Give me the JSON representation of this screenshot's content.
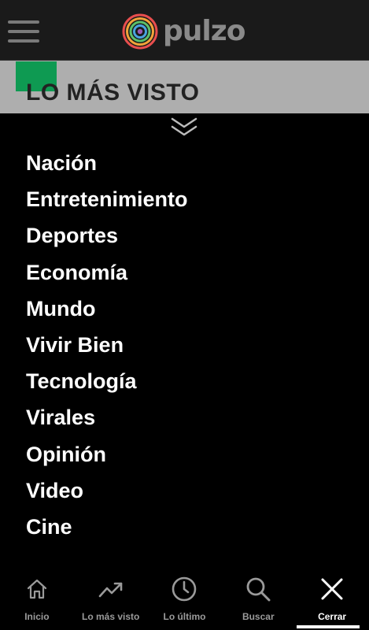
{
  "header": {
    "logo_text": "pulzo",
    "menu_icon": "hamburger-icon"
  },
  "banner": {
    "title": "LO MÁS VISTO",
    "accent_color": "#0e9a52"
  },
  "menu": {
    "items": [
      {
        "label": "Nación"
      },
      {
        "label": "Entretenimiento"
      },
      {
        "label": "Deportes"
      },
      {
        "label": "Economía"
      },
      {
        "label": "Mundo"
      },
      {
        "label": "Vivir Bien"
      },
      {
        "label": "Tecnología"
      },
      {
        "label": "Virales"
      },
      {
        "label": "Opinión"
      },
      {
        "label": "Video"
      },
      {
        "label": "Cine"
      }
    ]
  },
  "bottom_nav": {
    "items": [
      {
        "label": "Inicio",
        "icon": "home-icon"
      },
      {
        "label": "Lo más visto",
        "icon": "trending-icon"
      },
      {
        "label": "Lo último",
        "icon": "clock-icon"
      },
      {
        "label": "Buscar",
        "icon": "search-icon"
      },
      {
        "label": "Cerrar",
        "icon": "close-icon",
        "active": true
      }
    ]
  }
}
